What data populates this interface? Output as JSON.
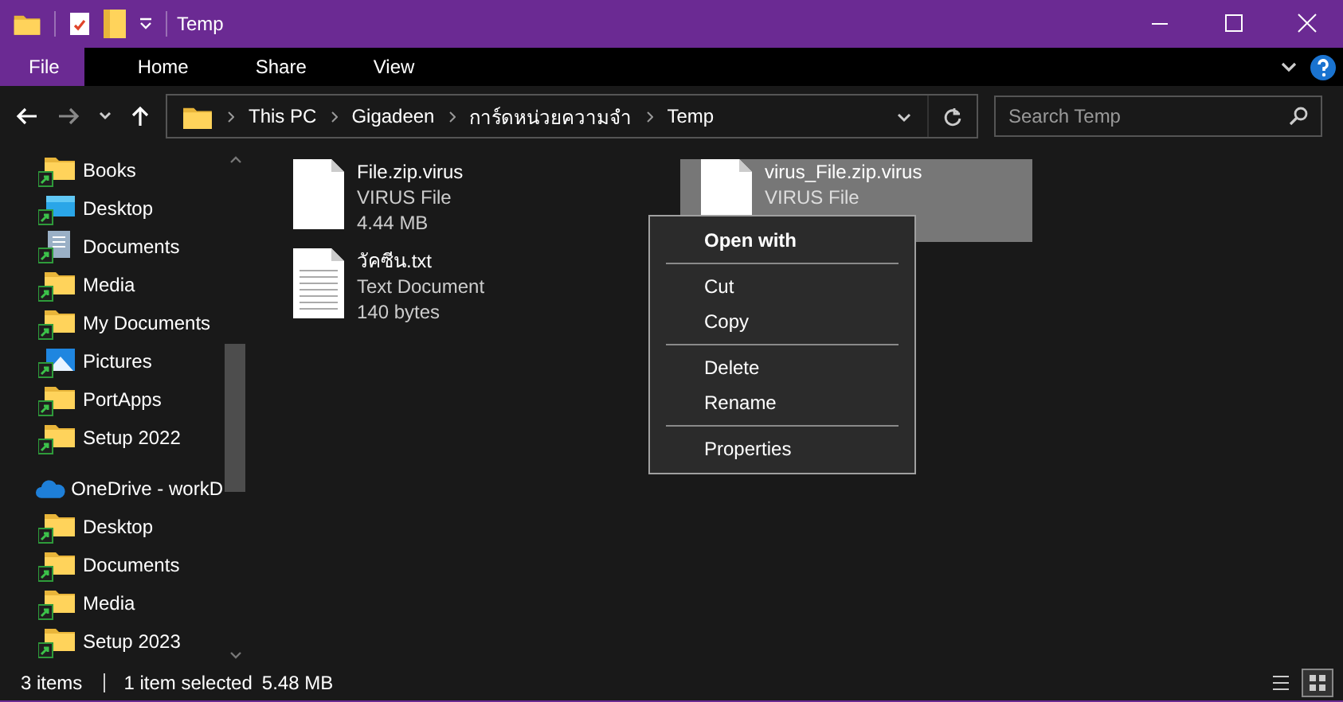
{
  "window": {
    "title": "Temp"
  },
  "ribbon": {
    "tabs": [
      {
        "label": "File",
        "kind": "file"
      },
      {
        "label": "Home",
        "kind": "tab"
      },
      {
        "label": "Share",
        "kind": "tab"
      },
      {
        "label": "View",
        "kind": "tab"
      }
    ]
  },
  "address": {
    "segments": [
      "This PC",
      "Gigadeen",
      "การ์ดหน่วยความจำ",
      "Temp"
    ]
  },
  "search": {
    "placeholder": "Search Temp"
  },
  "sidebar": {
    "items": [
      {
        "label": "Books",
        "kind": "folder"
      },
      {
        "label": "Desktop",
        "kind": "desktop"
      },
      {
        "label": "Documents",
        "kind": "documents"
      },
      {
        "label": "Media",
        "kind": "folder"
      },
      {
        "label": "My Documents",
        "kind": "folder"
      },
      {
        "label": "Pictures",
        "kind": "pictures"
      },
      {
        "label": "PortApps",
        "kind": "folder"
      },
      {
        "label": "Setup 2022",
        "kind": "folder"
      },
      {
        "label": "OneDrive - workD",
        "kind": "cloud"
      },
      {
        "label": "Desktop",
        "kind": "folder"
      },
      {
        "label": "Documents",
        "kind": "folder"
      },
      {
        "label": "Media",
        "kind": "folder"
      },
      {
        "label": "Setup 2023",
        "kind": "folder"
      }
    ]
  },
  "files": [
    {
      "name": "File.zip.virus",
      "type": "VIRUS File",
      "size": "4.44 MB",
      "kind": "blank",
      "selected": false
    },
    {
      "name": "วัคซีน.txt",
      "type": "Text Document",
      "size": "140 bytes",
      "kind": "text",
      "selected": false
    },
    {
      "name": "virus_File.zip.virus",
      "type": "VIRUS File",
      "kind": "blank",
      "selected": true
    }
  ],
  "context_menu": {
    "groups": [
      [
        {
          "label": "Open with",
          "bold": true
        }
      ],
      [
        {
          "label": "Cut",
          "bold": false
        },
        {
          "label": "Copy",
          "bold": false
        }
      ],
      [
        {
          "label": "Delete",
          "bold": false
        },
        {
          "label": "Rename",
          "bold": false
        }
      ],
      [
        {
          "label": "Properties",
          "bold": false
        }
      ]
    ]
  },
  "status_bar": {
    "item_count": "3 items",
    "selection": "1 item selected",
    "selection_size": "5.48 MB"
  }
}
